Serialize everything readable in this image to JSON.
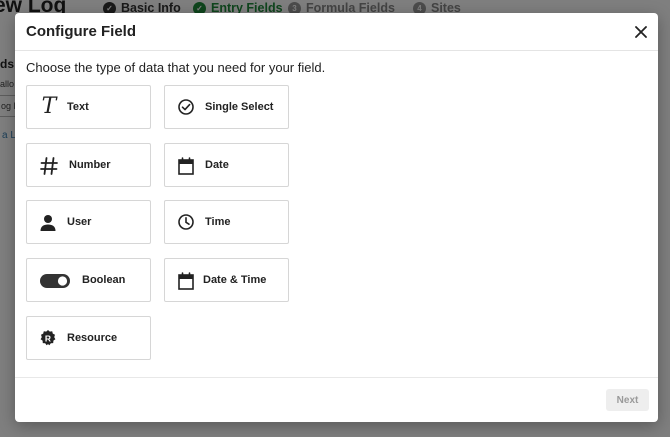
{
  "background": {
    "title": "ew Log",
    "steps": [
      {
        "number": "✓",
        "label": "Basic Info",
        "state": "done"
      },
      {
        "number": "✓",
        "label": "Entry Fields",
        "state": "active"
      },
      {
        "number": "3",
        "label": "Formula Fields",
        "state": "inactive"
      },
      {
        "number": "4",
        "label": "Sites",
        "state": "inactive"
      }
    ],
    "side_heading": "ds",
    "side_text": "allo",
    "side_button": "og E",
    "side_link": "a L"
  },
  "modal": {
    "title": "Configure Field",
    "subtitle": "Choose the type of data that you need for your field.",
    "options": [
      {
        "label": "Text",
        "icon": "text-icon"
      },
      {
        "label": "Single Select",
        "icon": "check-circle-icon"
      },
      {
        "label": "Number",
        "icon": "hash-icon"
      },
      {
        "label": "Date",
        "icon": "calendar-icon"
      },
      {
        "label": "User",
        "icon": "person-icon"
      },
      {
        "label": "Time",
        "icon": "clock-icon"
      },
      {
        "label": "Boolean",
        "icon": "toggle-icon"
      },
      {
        "label": "Date & Time",
        "icon": "calendar-icon"
      },
      {
        "label": "Resource",
        "icon": "resource-badge-icon"
      }
    ],
    "next_label": "Next"
  },
  "colors": {
    "accent_green": "#1f8a3a",
    "overlay": "rgba(0,0,0,0.5)",
    "disabled_button_bg": "#eeeeee"
  }
}
